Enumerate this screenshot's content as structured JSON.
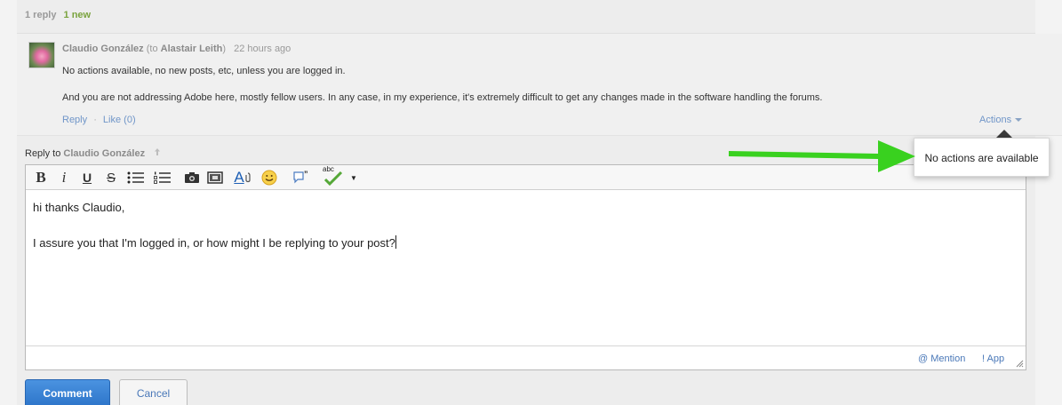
{
  "thread_meta": {
    "replies": "1 reply",
    "new_count": "1 new"
  },
  "post": {
    "author": "Claudio González",
    "to_prefix": "(to",
    "to_name": "Alastair Leith",
    "to_suffix": ")",
    "time": "22 hours ago",
    "body_lines": [
      "No actions available, no new posts, etc, unless you are logged in.",
      "And you are not addressing Adobe here, mostly fellow users. In any case, in my experience, it's extremely difficult to get any changes made in the software handling the forums."
    ],
    "reply_label": "Reply",
    "separator": "·",
    "like_label": "Like (0)",
    "actions_label": "Actions"
  },
  "reply": {
    "prefix": "Reply to",
    "name": "Claudio González",
    "editor_lines": [
      "hi thanks Claudio,",
      "I assure you that I'm logged in, or how might I be replying to your post?"
    ],
    "mention_label": "@ Mention",
    "app_label": "! App",
    "comment_label": "Comment",
    "cancel_label": "Cancel"
  },
  "toolbar": {
    "bold": "B",
    "italic": "i",
    "underline": "U",
    "strike": "S",
    "font_icon_text": "A",
    "spell_text": "abc"
  },
  "popover": {
    "message": "No actions are available"
  },
  "colors": {
    "accent_link": "#6f95c8",
    "new_badge": "#7aa33e",
    "primary_button": "#2d74c9",
    "annotation_arrow": "#39d11f"
  },
  "icons": {
    "up_arrow": "arrow-up-icon",
    "image": "image-icon",
    "media": "media-icon",
    "emoji": "smiley-icon",
    "quote": "quote-icon",
    "spellcheck": "spellcheck-icon"
  }
}
